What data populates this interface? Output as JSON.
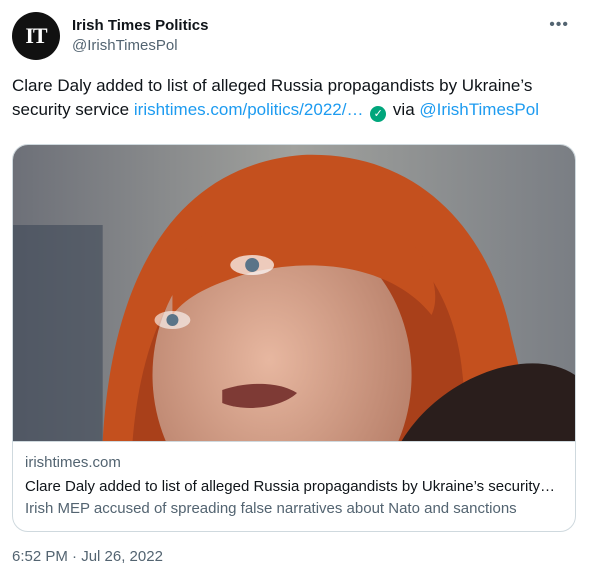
{
  "author": {
    "avatar_text": "IT",
    "display_name": "Irish Times Politics",
    "handle": "@IrishTimesPol"
  },
  "tweet": {
    "text": "Clare Daly added to list of alleged Russia propagandists by Ukraine’s security service ",
    "link": "irishtimes.com/politics/2022/…",
    "via": " via ",
    "mention": "@IrishTimesPol"
  },
  "card": {
    "domain": "irishtimes.com",
    "title": "Clare Daly added to list of alleged Russia propagandists by Ukraine’s security…",
    "description": "Irish MEP accused of spreading false narratives about Nato and sanctions"
  },
  "timestamp": "6:52 PM · Jul 26, 2022",
  "icons": {
    "more": "more-icon",
    "verified": "verified-check-icon"
  },
  "colors": {
    "link": "#1d9bf0",
    "check": "#00a67c",
    "hair": "#c4501e"
  }
}
